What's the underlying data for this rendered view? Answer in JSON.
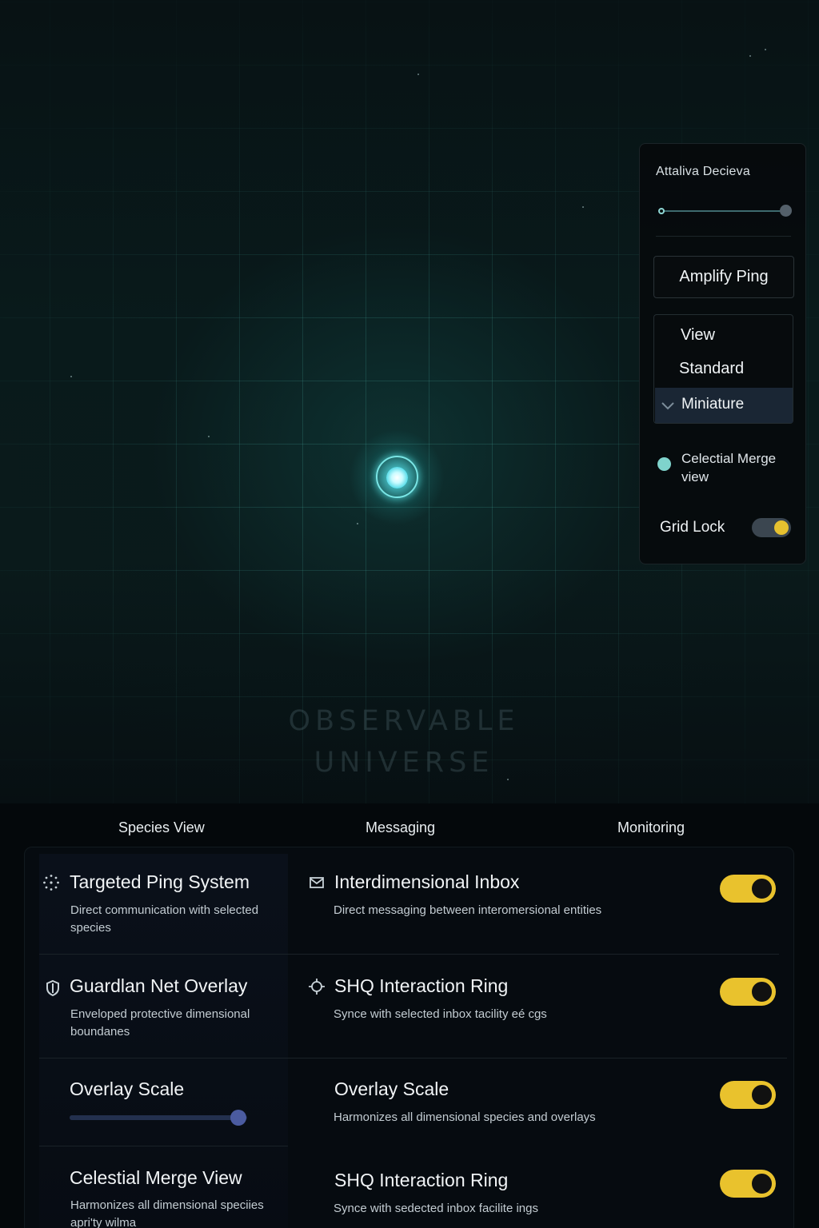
{
  "map": {
    "watermark_line1": "OBSERVABLE",
    "watermark_line2": "UNIVERSE"
  },
  "side_panel": {
    "title": "Attaliva Decieva",
    "slider_value": 1.0,
    "amplify_button": "Amplify Ping",
    "view": {
      "label": "View",
      "options": [
        "Standard",
        "Miniature"
      ],
      "selected": "Miniature"
    },
    "celestial_merge": {
      "label": "Celectial Merge view",
      "selected": true
    },
    "grid_lock": {
      "label": "Grid Lock",
      "on": true
    }
  },
  "tabs": [
    "Species View",
    "Messaging",
    "Monitoring"
  ],
  "left_items": [
    {
      "title": "Targeted Ping System",
      "desc": "Direct communication with selected species",
      "icon": "ping-dots-icon"
    },
    {
      "title": "Guardlan Net Overlay",
      "desc": "Enveloped protective dimensional boundanes",
      "icon": "shield-icon"
    },
    {
      "title": "Overlay Scale",
      "slider_value": 0.95
    },
    {
      "title": "Celestial Merge View",
      "desc": "Harmonizes all dimensional speciies apri'ty wilma"
    }
  ],
  "right_items": [
    {
      "title": "Interdimensional Inbox",
      "desc": "Direct messaging between interomersional entities",
      "icon": "envelope-icon",
      "toggle_on": true
    },
    {
      "title": "SHQ Interaction Ring",
      "desc": "Synce with selected inbox tacility eé cgs",
      "icon": "crosshair-icon",
      "toggle_on": true
    },
    {
      "title": "Overlay Scale",
      "desc": "Harmonizes all dimensional species and overlays",
      "toggle_on": true
    },
    {
      "title": "SHQ Interaction Ring",
      "desc": "Synce with sedected inbox facilite ings",
      "toggle_on": true
    }
  ],
  "colors": {
    "accent_yellow": "#e9c22d",
    "ping_cyan": "#49d8e6",
    "radio_teal": "#7fd3cc"
  }
}
